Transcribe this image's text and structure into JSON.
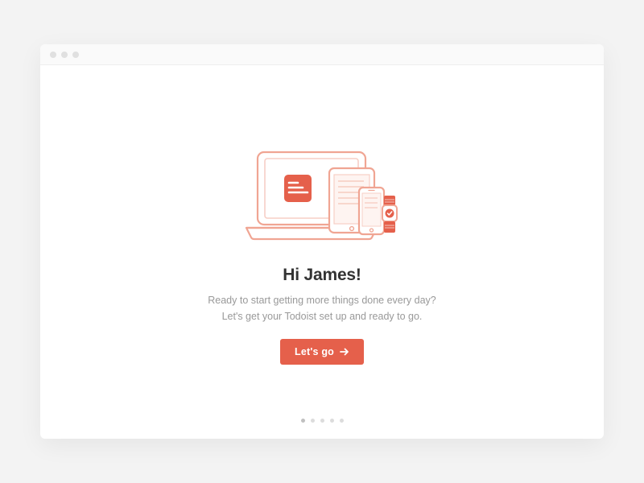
{
  "onboarding": {
    "greeting": "Hi James!",
    "subtitle_line1": "Ready to start getting more things done every day?",
    "subtitle_line2": "Let's get your Todoist set up and ready to go.",
    "cta_label": "Let's go"
  },
  "illustration": {
    "icon_name": "devices-illustration"
  },
  "pager": {
    "total": 5,
    "current": 0
  },
  "colors": {
    "accent": "#e5604b",
    "accent_light": "#f7b9ae",
    "text_primary": "#333333",
    "text_secondary": "#999999"
  }
}
